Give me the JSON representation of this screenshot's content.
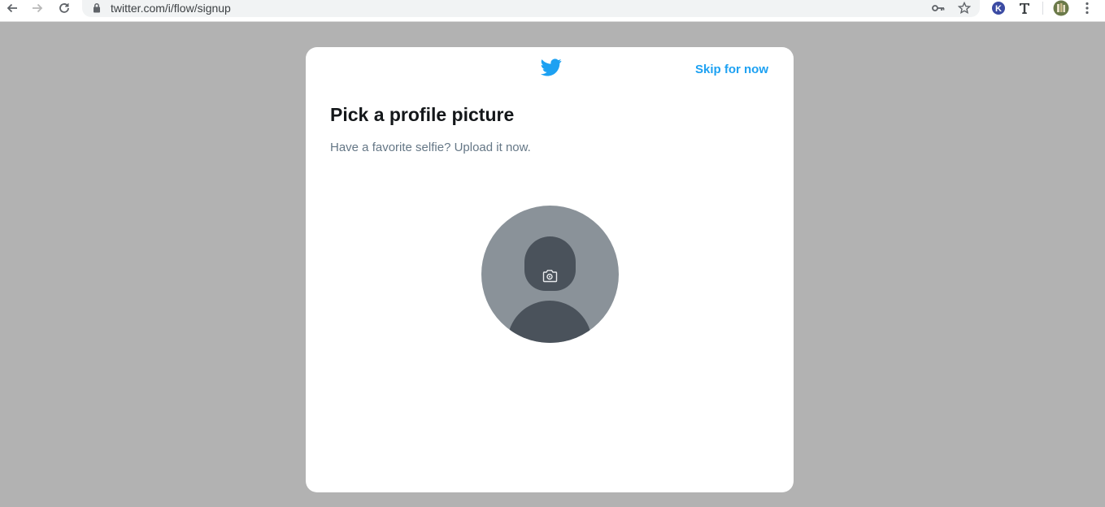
{
  "browser": {
    "url": "twitter.com/i/flow/signup"
  },
  "modal": {
    "skip_label": "Skip for now",
    "title": "Pick a profile picture",
    "subtitle": "Have a favorite selfie? Upload it now."
  },
  "colors": {
    "brand": "#1da1f2",
    "backdrop": "#b2b2b2",
    "avatar_bg": "#8a9299",
    "avatar_figure": "#4a525b"
  },
  "icons": {
    "back": "back-arrow-icon",
    "forward": "forward-arrow-icon",
    "reload": "reload-icon",
    "lock": "lock-icon",
    "key": "key-icon",
    "star": "bookmark-star-icon",
    "ext_k": "k-extension-icon",
    "ext_t": "t-extension-icon",
    "profile": "profile-avatar-icon",
    "menu": "kebab-menu-icon",
    "logo": "twitter-bird-icon",
    "camera": "camera-icon"
  }
}
